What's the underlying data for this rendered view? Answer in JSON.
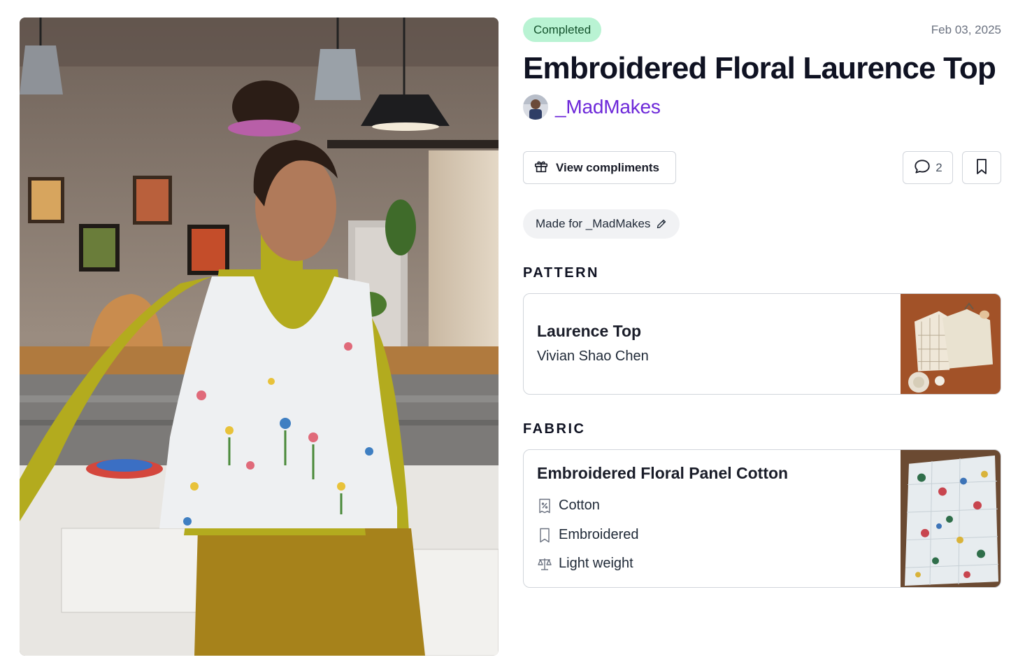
{
  "photo": {
    "alt": ""
  },
  "post": {
    "status": "Completed",
    "date": "Feb 03, 2025",
    "title": "Embroidered Floral Laurence Top",
    "author": "_MadMakes"
  },
  "actions": {
    "compliments_label": "View compliments",
    "comments_count": "2",
    "compliments_icon": "gift-icon",
    "comments_icon": "comment-icon",
    "bookmark_icon": "bookmark-icon"
  },
  "made_for": {
    "label": "Made for _MadMakes",
    "icon": "pencil-icon"
  },
  "pattern": {
    "heading": "PATTERN",
    "name": "Laurence Top",
    "designer": "Vivian Shao Chen"
  },
  "fabric": {
    "heading": "FABRIC",
    "name": "Embroidered Floral Panel Cotton",
    "attributes": [
      {
        "icon": "composition-tag-icon",
        "label": "Cotton"
      },
      {
        "icon": "bookmark-outline-icon",
        "label": "Embroidered"
      },
      {
        "icon": "scale-icon",
        "label": "Light weight"
      }
    ]
  },
  "colors": {
    "status_bg": "#b9f3d3",
    "status_text": "#14532d",
    "author_link": "#6d28d9",
    "border": "#d1d5db",
    "chip_bg": "#f1f2f4"
  }
}
